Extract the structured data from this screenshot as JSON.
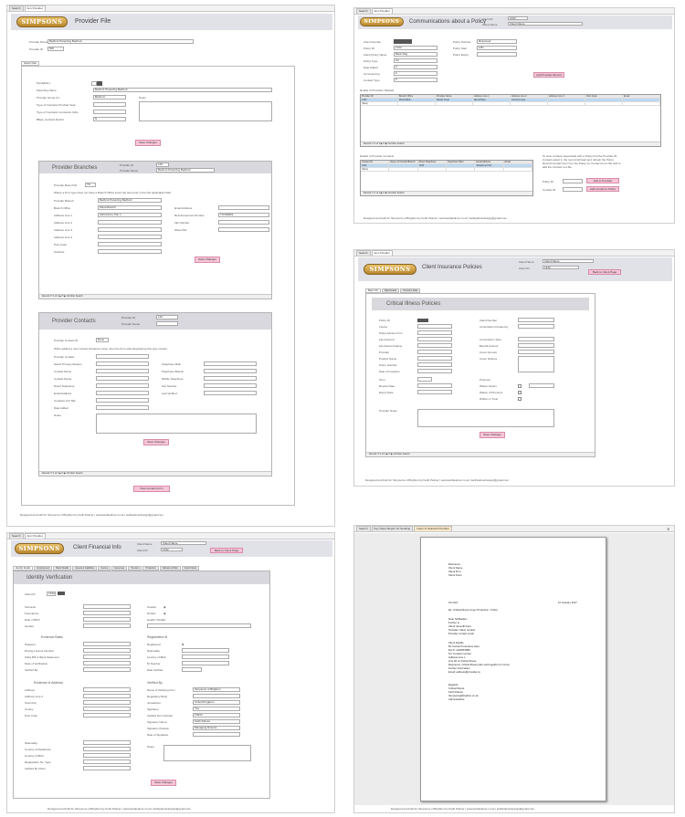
{
  "panel1": {
    "tabs": [
      "Search",
      "Ann Provider"
    ],
    "logo": "SIMPSONS",
    "title": "Provider File",
    "provider_name_label": "Provider Name",
    "provider_name_value": "Bedfont Parenting Bedford",
    "provider_id_label": "Provider ID",
    "provider_id_value": "526",
    "form_tab": "Search Filter",
    "fields": [
      {
        "label": "Pend(ExtL)",
        "value": ""
      },
      {
        "label": "Parenting Name",
        "value": "Bedfont Parenting Bedford"
      },
      {
        "label": "Provider Group (1)",
        "value": "Bedford"
      },
      {
        "label": "Type of Contracts Provider Seal",
        "value": ""
      },
      {
        "label": "Type of Contracts Contractor Gifts",
        "value": ""
      },
      {
        "label": "Billed_Contract Reimb",
        "value": "N"
      }
    ],
    "notes_label": "Notes",
    "save_button": "Save Changes",
    "branches": {
      "title": "Provider Branches",
      "provider_id_label": "Provider ID",
      "provider_id_value": "120",
      "provider_name_label": "Provider Name",
      "provider_name_value": "Bedfont Parenting Bedford",
      "branch_id_label": "Provider Branch ID",
      "branch_id_value": "Tfc",
      "note": "Where a Prov type does not have a Branch Office insert the text  enter in the Not applicable Field",
      "left_fields": [
        {
          "label": "Provider Branch",
          "value": "Bedfont Parenting Bedford"
        },
        {
          "label": "Branch Office",
          "value": "Plaza Branch"
        },
        {
          "label": "Address Line 1",
          "value": "Ashtonbury Pan 1"
        },
        {
          "label": "Address Line 2",
          "value": ""
        },
        {
          "label": "Address Line 3",
          "value": ""
        },
        {
          "label": "Address Line 4",
          "value": ""
        },
        {
          "label": "Post Code",
          "value": ""
        },
        {
          "label": "Tele/Fax",
          "value": ""
        }
      ],
      "right_fields": [
        {
          "label": "Email Address",
          "value": ""
        },
        {
          "label": "Reimbursement Number",
          "value": "TICKER22"
        },
        {
          "label": "File Number",
          "value": ""
        },
        {
          "label": "Sheet Ref",
          "value": ""
        }
      ],
      "save_button": "Save Changes",
      "nav": "Record: H 1 of 1 ▶ H ▶ No Filter  Search"
    },
    "contacts": {
      "title": "Provider Contacts",
      "provider_id_label": "Provider ID",
      "provider_id_value": "120",
      "provider_name_label": "Provider Name",
      "contact_id_label": "Provider Contact ID",
      "contact_id_value": "None",
      "note": "When adding a new contact first Enter name, then the ID to start Registering this type contact",
      "left_fields": [
        {
          "label": "Provider Contact",
          "value": ""
        },
        {
          "label": "Select Primary Reason",
          "value": ""
        },
        {
          "label": "Contact Name",
          "value": ""
        },
        {
          "label": "Contact Name",
          "value": ""
        },
        {
          "label": "Direct Telephone",
          "value": ""
        },
        {
          "label": "Email Address",
          "value": ""
        },
        {
          "label": "Contacts Job Title",
          "value": ""
        },
        {
          "label": "Date Added",
          "value": ""
        }
      ],
      "right_fields": [
        {
          "label": "Telephone Main",
          "value": ""
        },
        {
          "label": "Telephone Branch",
          "value": ""
        },
        {
          "label": "Mobile Telephone",
          "value": ""
        },
        {
          "label": "Fax Number",
          "value": ""
        },
        {
          "label": "Last Verified",
          "value": ""
        }
      ],
      "notes_label": "Notes",
      "save_button": "Save Changes",
      "nav": "Record: H 1 of 1 ▶ H ▶ No Filter  Search"
    },
    "bottom_button": "New Contact Form",
    "footer": "Designed and built for Simpsons of Brighton by Keith Palmer | www.keithpalmer.co.uk | keithpalmerdesign@gmail.com"
  },
  "panel2": {
    "tabs": [
      "Search",
      "Ann Provider"
    ],
    "logo": "SIMPSONS",
    "title": "Communications about a Policy",
    "head_label_1": "Client ID",
    "head_value_1": "1342",
    "head_label_2": "Client Name",
    "head_value_2": "Client Name",
    "left_fields": [
      {
        "label": "Client Number",
        "value": ""
      },
      {
        "label": "Policy ID",
        "value": "1342"
      },
      {
        "label": "Client Policy Name",
        "value": "Bank Reg"
      },
      {
        "label": "Policy Type",
        "value": "On"
      },
      {
        "label": "Date Added",
        "value": "0"
      },
      {
        "label": "Commencing",
        "value": "0"
      },
      {
        "label": "Contact Type",
        "value": "0"
      }
    ],
    "right_fields": [
      {
        "label": "Policy Number",
        "value": "Reinwood"
      },
      {
        "label": "Policy Start",
        "value": "1/61"
      },
      {
        "label": "Policy Expiry",
        "value": ""
      }
    ],
    "btn_new": "Add Provider Record",
    "grid1_title": "Details of Providers Related",
    "grid1_headers": [
      "Provider ID",
      "Branch Office",
      "Provider Name",
      "Address Line 1",
      "Address Line 2",
      "Address Line 3",
      "Post Code",
      "Email"
    ],
    "grid1_rows": [
      [
        "1342",
        "Plaza Bank",
        "Reeds Court",
        "Recaf Main",
        "Camera Lane",
        "",
        "",
        ""
      ],
      [
        "(New)",
        "",
        "",
        "",
        "",
        "",
        "",
        ""
      ]
    ],
    "grid1_nav": "Record: H 1 of 1 ▶ H ▶ No Filter  Search",
    "grid2_title": "Details of Provider Contacts",
    "grid2_headers": [
      "Contact ID",
      "Name of Contact/Branch",
      "Direct Telephone",
      "Telephone Main",
      "Email Address",
      "Email"
    ],
    "grid2_rows": [
      [
        "1201",
        "",
        "1234",
        "",
        "Telephone Hub",
        ""
      ],
      [
        "(New)",
        "",
        "",
        "",
        "",
        ""
      ]
    ],
    "grid2_nav": "Record: H 1 of 1 ▶ H ▶ No Filter  Search",
    "side_note": "To view contacts associated with a Policy find the Provider ID, Contact select it, the record will load and refresh the Policy Record Contact Form For the Policy (or Contact Form ID) with to add the Contact to a file.",
    "side_label_1": "Policy ID",
    "side_label_2": "Contact ID",
    "side_btn_1": "Add to Provider",
    "side_btn_2": "Add contact to Policy",
    "footer": "Designed and built for Simpsons of Brighton by Keith Palmer | www.keithpalmer.co.uk | keithpalmerdesign@gmail.com"
  },
  "panel3": {
    "tabs": [
      "Search",
      "Ann Provider"
    ],
    "logo": "SIMPSONS",
    "title": "Client Insurance Policies",
    "head_label_1": "Client Name",
    "head_value_1": "Client Name",
    "head_label_2": "Client ID",
    "head_value_2": "1342",
    "head_button": "Back to Client Page",
    "form_tabs": [
      "Basic Info",
      "Risk Details",
      "Premium Data"
    ],
    "section_title": "Critical Illness Policies",
    "left_fields": [
      {
        "label": "Policy ID",
        "value": ""
      },
      {
        "label": "Insurer",
        "value": ""
      },
      {
        "label": "Policy Advice Form",
        "value": ""
      },
      {
        "label": "Life Assured",
        "value": ""
      },
      {
        "label": "Life Assured Name",
        "value": ""
      },
      {
        "label": "Provider",
        "value": ""
      },
      {
        "label": "Product Name",
        "value": ""
      },
      {
        "label": "Policy Number",
        "value": ""
      },
      {
        "label": "Date of Inception",
        "value": ""
      },
      {
        "label": "Term",
        "value": ""
      },
      {
        "label": "Review Date",
        "value": ""
      },
      {
        "label": "Expiry Date",
        "value": ""
      }
    ],
    "right_fields": [
      {
        "label": "Client Number",
        "value": ""
      },
      {
        "label": "Commission Frequency",
        "value": ""
      },
      {
        "label": "Commission Type",
        "value": ""
      },
      {
        "label": "Benefit Amount",
        "value": ""
      },
      {
        "label": "Cover Amount",
        "value": ""
      },
      {
        "label": "Cover Options",
        "value": ""
      },
      {
        "label": "Premium",
        "value": ""
      },
      {
        "label": "Waiver Option",
        "value": "0%"
      },
      {
        "label": "Waiver of Premium",
        "value": ""
      },
      {
        "label": "Written in Trust",
        "value": ""
      }
    ],
    "notes_label": "Provider Notes",
    "save_button": "Save Changes",
    "nav": "Record: H 1 of 1 ▶ H ▶ No Filter  Search",
    "footer": "Designed and built for Simpsons of Brighton by Keith Palmer | www.keithpalmer.co.uk | keithpalmerdesign@gmail.com"
  },
  "panel4": {
    "tabs": [
      "Search",
      "Ann Provider"
    ],
    "logo": "SIMPSONS",
    "title": "Client Financial Info",
    "head_label_1": "Client Name",
    "head_value_1": "Client Name",
    "head_label_2": "Client ID",
    "head_value_2": "1342",
    "head_button": "Back to Client Page",
    "form_tabs": [
      "Identity Details",
      "Employment",
      "Bank Details",
      "Assets & Liabilities",
      "Income",
      "Expenses",
      "Pension",
      "Protection",
      "Attitude to Risk",
      "Client Notes"
    ],
    "section_title": "Identity Verification",
    "client_id_label": "Client ID",
    "client_id_value": "1342",
    "left_fields": [
      {
        "label": "Surname",
        "value": ""
      },
      {
        "label": "Forenames",
        "value": ""
      },
      {
        "label": "Date of Birth",
        "value": ""
      },
      {
        "label": "Gender",
        "value": ""
      }
    ],
    "right_fields": [
      {
        "label": "Smoker",
        "value": ""
      },
      {
        "label": "Drinker",
        "value": ""
      },
      {
        "label": "Health / Details",
        "value": ""
      }
    ],
    "evidence_title": "Evidence Basis",
    "evidence_fields": [
      {
        "label": "Passport",
        "value": ""
      },
      {
        "label": "Driving Licence Number",
        "value": ""
      },
      {
        "label": "Utility Bill or Bank Statement",
        "value": ""
      },
      {
        "label": "Date of Verification",
        "value": ""
      },
      {
        "label": "Verified By",
        "value": ""
      }
    ],
    "reg_title": "Registration B",
    "reg_fields": [
      {
        "label": "Registered",
        "value": ""
      },
      {
        "label": "Nationality",
        "value": ""
      },
      {
        "label": "Country of Birth",
        "value": ""
      },
      {
        "label": "NI Number",
        "value": ""
      },
      {
        "label": "Date Verified",
        "value": ""
      }
    ],
    "address_title": "Evidence of Address",
    "address_fields": [
      {
        "label": "Address",
        "value": ""
      },
      {
        "label": "Address Line 2",
        "value": ""
      },
      {
        "label": "Town/City",
        "value": ""
      },
      {
        "label": "County",
        "value": ""
      },
      {
        "label": "Post Code",
        "value": ""
      }
    ],
    "verified_title": "Verified By",
    "verified_fields": [
      {
        "label": "Name of Verifying Firm",
        "value": "Simpsons of Brighton"
      },
      {
        "label": "Regulatory Body",
        "value": ""
      },
      {
        "label": "Jurisdiction",
        "value": "United Kingdom"
      },
      {
        "label": "Signature",
        "value": "Yes"
      },
      {
        "label": "Verified Firm Number",
        "value": "F0234"
      },
      {
        "label": "Signatory Name",
        "value": "Keith Palmer"
      },
      {
        "label": "Signatory Position",
        "value": "Managing Director"
      },
      {
        "label": "Date of Signature",
        "value": ""
      }
    ],
    "lower_fields": [
      {
        "label": "Nationality",
        "value": ""
      },
      {
        "label": "Country of Residence",
        "value": ""
      },
      {
        "label": "Country of Birth",
        "value": ""
      },
      {
        "label": "Registration No. Type",
        "value": ""
      },
      {
        "label": "Verified By Client",
        "value": ""
      }
    ],
    "notes_label": "Notes",
    "save_button": "Save Changes",
    "footer": "Designed and built for Simpsons of Brighton by Keith Palmer | www.keithpalmer.co.uk | keithpalmerdesign@gmail.com"
  },
  "panel5": {
    "tabs": [
      "Search",
      "Key Client Report for Sending",
      "Letter to Selected Provider"
    ],
    "address_block": [
      "Reference",
      "Client Name",
      "Client Firm",
      "Client Town"
    ],
    "date_line": "12 January 2017",
    "ref_line": "Our Ref:",
    "re_line": "Re: Critical Illness Cover Protection - Policy",
    "body_block_1": [
      "Dear Sir/Madam",
      "Further to",
      "Client name/ID here",
      "Provider/ Client number",
      "Provider contact email"
    ],
    "body_block_2": [
      "Client Details",
      "Mr Contact Forename Here",
      "Ref #: 1234567890",
      "Tel: Contact number",
      "Address Line 1",
      "Line #2 of Critical Illness",
      "Reference: Critical Illness plan sold together for Cover",
      "Further information",
      "Email: address@provider.co"
    ],
    "sign_block": [
      "Regards",
      "Critical Illness",
      "Keith Palmer",
      "Simpsons@brighton.co.uk",
      "Administrative"
    ],
    "footer": "Designed and built for Simpsons of Brighton by Keith Palmer | www.keithpalmer.co.uk | keithpalmerdesign@gmail.com"
  }
}
